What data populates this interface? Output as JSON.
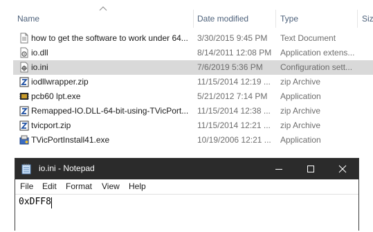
{
  "explorer": {
    "columns": {
      "name": "Name",
      "date_modified": "Date modified",
      "type": "Type",
      "size": "Siz"
    },
    "files": [
      {
        "name": "how to get the software to work under 64...",
        "date": "3/30/2015 9:45 PM",
        "type": "Text Document",
        "icon": "text-document-icon",
        "selected": false
      },
      {
        "name": "io.dll",
        "date": "8/14/2011 12:08 PM",
        "type": "Application extens...",
        "icon": "dll-gear-icon",
        "selected": false
      },
      {
        "name": "io.ini",
        "date": "7/6/2019 5:36 PM",
        "type": "Configuration sett...",
        "icon": "config-file-icon",
        "selected": true
      },
      {
        "name": "iodllwrapper.zip",
        "date": "11/15/2014 12:19 ...",
        "type": "zip Archive",
        "icon": "zip-archive-icon",
        "selected": false
      },
      {
        "name": "pcb60 lpt.exe",
        "date": "5/21/2012 7:14 PM",
        "type": "Application",
        "icon": "chip-exe-icon",
        "selected": false
      },
      {
        "name": "Remapped-IO.DLL-64-bit-using-TVicPort...",
        "date": "11/15/2014 12:38 ...",
        "type": "zip Archive",
        "icon": "zip-archive-icon",
        "selected": false
      },
      {
        "name": "tvicport.zip",
        "date": "11/15/2014 12:21 ...",
        "type": "zip Archive",
        "icon": "zip-archive-icon",
        "selected": false
      },
      {
        "name": "TVicPortInstall41.exe",
        "date": "10/19/2006 12:21 ...",
        "type": "Application",
        "icon": "installer-icon",
        "selected": false
      }
    ]
  },
  "notepad": {
    "title": "io.ini - Notepad",
    "menu": [
      "File",
      "Edit",
      "Format",
      "View",
      "Help"
    ],
    "content": "0xDFF8"
  },
  "colors": {
    "titlebar": "#2b2b2b",
    "selection": "#d9d9d9",
    "header_text": "#4c607a",
    "secondary_text": "#6d6d6d"
  }
}
